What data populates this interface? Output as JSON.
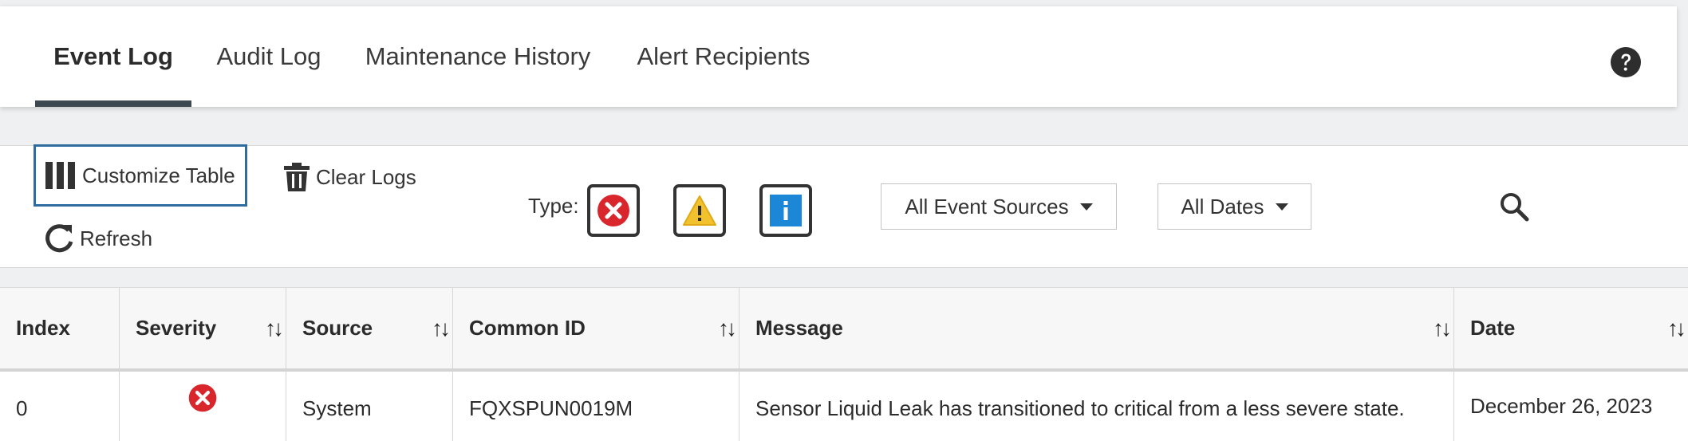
{
  "tabs": [
    {
      "label": "Event Log",
      "active": true
    },
    {
      "label": "Audit Log",
      "active": false
    },
    {
      "label": "Maintenance History",
      "active": false
    },
    {
      "label": "Alert Recipients",
      "active": false
    }
  ],
  "header": {
    "help_icon": "question-circle-icon"
  },
  "toolbar": {
    "customize_label": "Customize Table",
    "clear_logs_label": "Clear Logs",
    "refresh_label": "Refresh",
    "type_label": "Type:",
    "type_filters": [
      {
        "name": "error",
        "icon": "error-x-icon",
        "color": "#d9262c"
      },
      {
        "name": "warning",
        "icon": "warning-triangle-icon",
        "color": "#f2c12e"
      },
      {
        "name": "info",
        "icon": "info-icon",
        "color": "#1b87d6"
      }
    ],
    "event_sources_selected": "All Event Sources",
    "dates_selected": "All Dates",
    "search_icon": "search-icon"
  },
  "table": {
    "columns": [
      "Index",
      "Severity",
      "Source",
      "Common ID",
      "Message",
      "Date"
    ],
    "rows": [
      {
        "index": "0",
        "severity": "error",
        "source": "System",
        "common_id": "FQXSPUN0019M",
        "message": "Sensor Liquid Leak has transitioned to critical from a less severe state.",
        "date": "December 26, 2023"
      }
    ]
  },
  "colors": {
    "accent": "#3d4851",
    "focus_border": "#2f6ca0",
    "error": "#d9262c",
    "warning": "#f2c12e",
    "info": "#1b87d6"
  }
}
